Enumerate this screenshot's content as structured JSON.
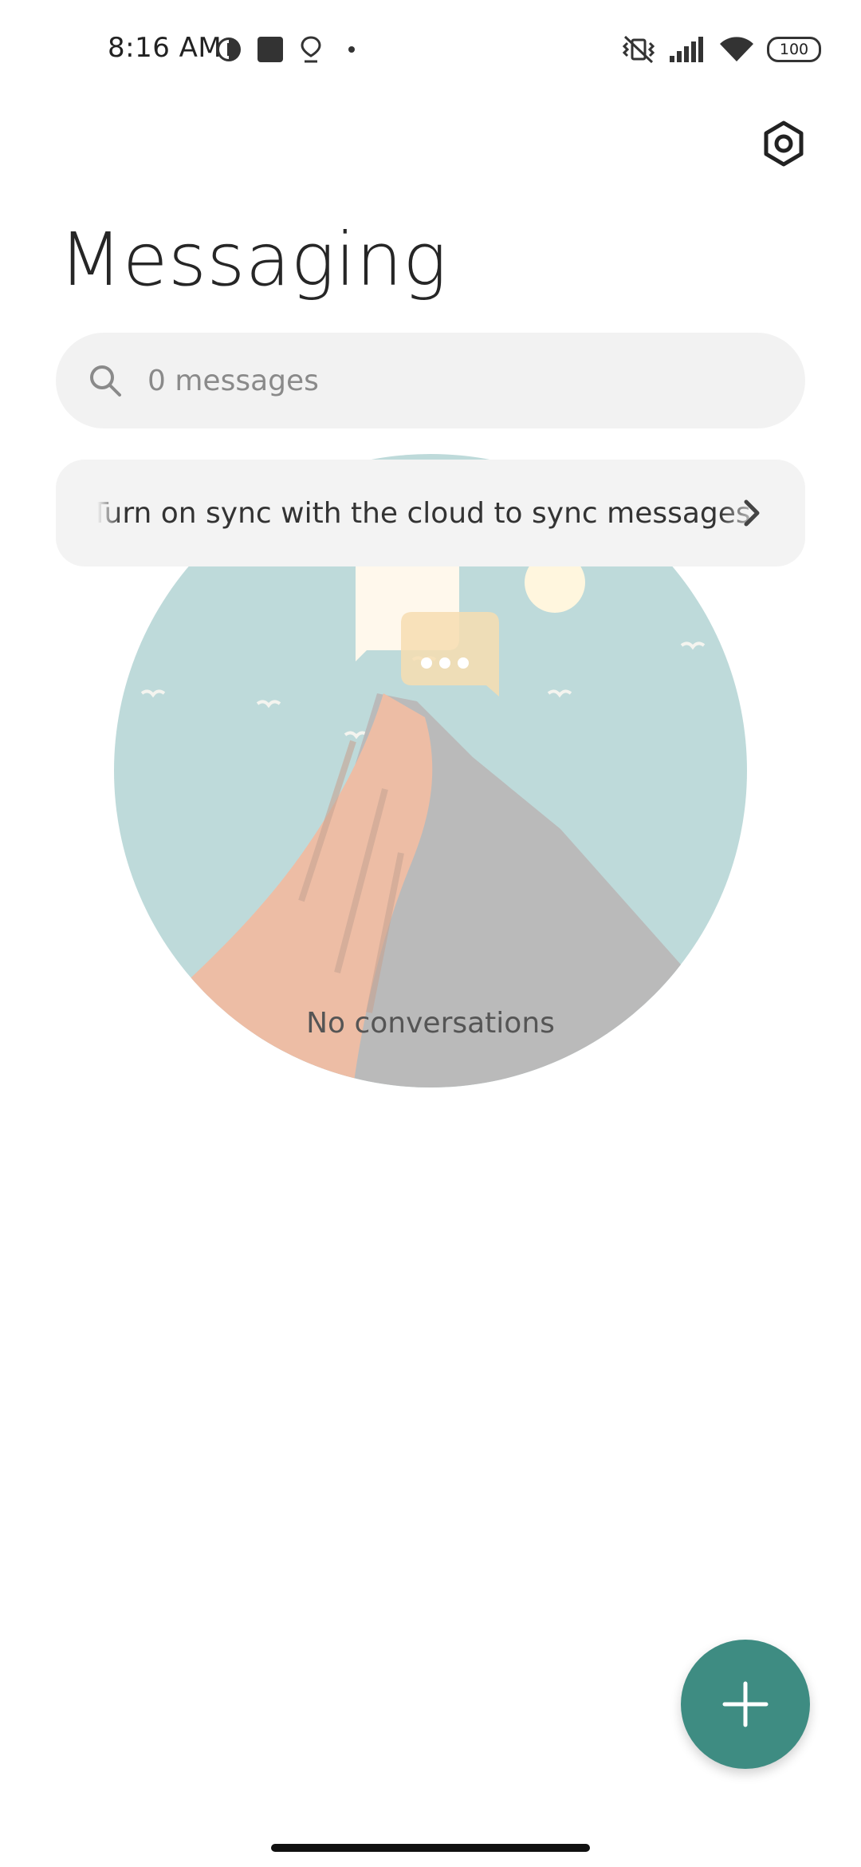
{
  "status_bar": {
    "time": "8:16 AM",
    "battery": "100",
    "left_icons": [
      "data-saver-icon",
      "square-icon",
      "location-pin-icon",
      "dot-icon"
    ],
    "right_icons": [
      "vibrate-off-icon",
      "signal-icon",
      "wifi-icon",
      "battery-icon"
    ]
  },
  "header": {
    "title": "Messaging",
    "settings_icon": "settings-hexagon-icon"
  },
  "search": {
    "placeholder": "0 messages"
  },
  "sync_banner": {
    "text": "Turn on sync with the cloud to sync messages"
  },
  "empty_state": {
    "label": "No conversations"
  },
  "fab": {
    "icon": "plus-icon",
    "color": "#3e8c82"
  },
  "colors": {
    "accent": "#3e8c82",
    "search_bg": "#f2f2f2",
    "banner_bg": "#f3f3f3"
  }
}
